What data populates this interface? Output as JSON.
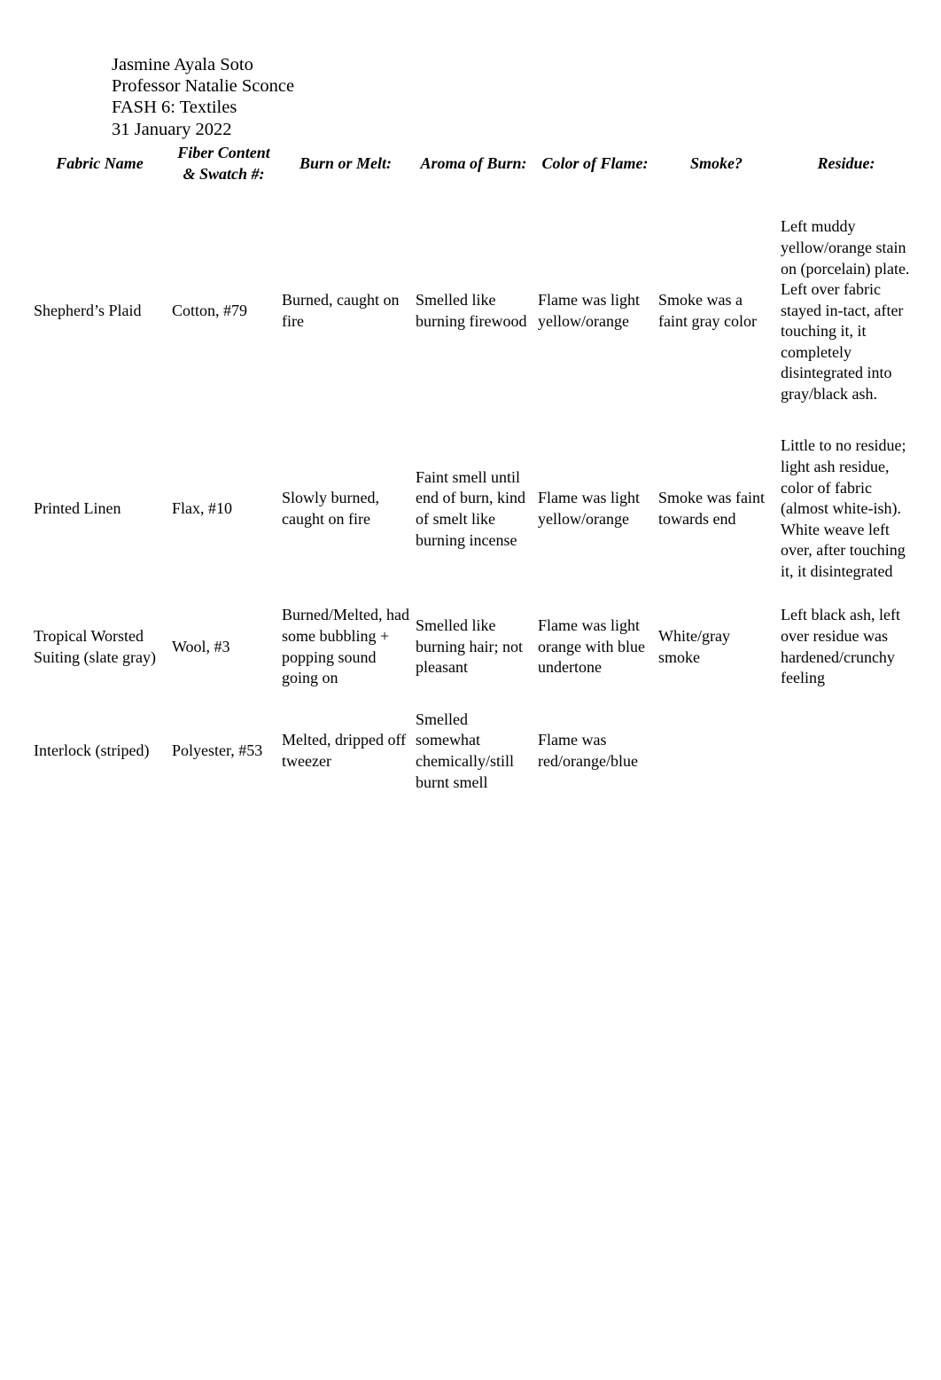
{
  "document": {
    "header": {
      "student_name": "Jasmine Ayala Soto",
      "professor": "Professor Natalie Sconce",
      "course": "FASH 6: Textiles",
      "date": "31 January 2022"
    },
    "table": {
      "columns": [
        "Fabric Name",
        "Fiber Content & Swatch #:",
        "Burn or Melt:",
        "Aroma of Burn:",
        "Color of Flame:",
        "Smoke?",
        "Residue:"
      ],
      "column_lines": {
        "fiber_line1": "Fiber Content",
        "fiber_line2": "& Swatch #:"
      },
      "rows": [
        {
          "fabric_name": "Shepherd’s Plaid",
          "fiber_swatch": "Cotton, #79",
          "burn_or_melt": "Burned, caught on fire",
          "aroma": "Smelled like burning firewood",
          "flame_color": "Flame was light yellow/orange",
          "smoke": "Smoke was a faint gray color",
          "residue": "Left muddy yellow/orange stain on (porcelain) plate. Left over fabric stayed in-tact, after touching it, it completely disintegrated into gray/black ash."
        },
        {
          "fabric_name": "Printed Linen",
          "fiber_swatch": "Flax, #10",
          "burn_or_melt": "Slowly burned, caught on fire",
          "aroma": "Faint smell until end of burn, kind of smelt like burning incense",
          "flame_color": "Flame was light yellow/orange",
          "smoke": "Smoke was faint towards end",
          "residue": "Little to no residue; light ash residue, color of fabric (almost white-ish). White weave left over, after touching it, it disintegrated"
        },
        {
          "fabric_name": "Tropical Worsted Suiting (slate gray)",
          "fiber_swatch": "Wool, #3",
          "burn_or_melt": "Burned/Melted, had some bubbling + popping sound going on",
          "aroma": "Smelled like burning hair; not pleasant",
          "flame_color": "Flame was light orange with blue undertone",
          "smoke": "White/gray smoke",
          "residue": "Left black ash, left over residue was hardened/crunchy feeling"
        },
        {
          "fabric_name": "Interlock (striped)",
          "fiber_swatch": "Polyester, #53",
          "burn_or_melt": "Melted, dripped off tweezer",
          "aroma": "Smelled somewhat chemically/still burnt smell",
          "flame_color": "Flame was red/orange/blue",
          "smoke": "",
          "residue": ""
        }
      ]
    }
  }
}
